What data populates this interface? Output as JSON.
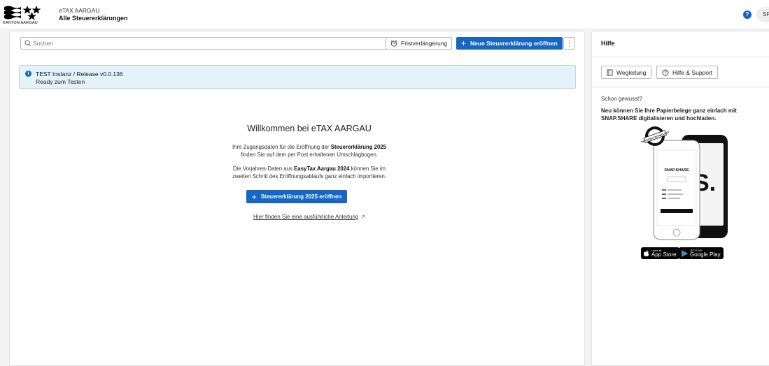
{
  "header": {
    "logo_text": "KANTON AARGAU",
    "app_name": "eTAX AARGAU",
    "page_title": "Alle Steuererklärungen",
    "help_icon_glyph": "?",
    "avatar_initials": "SP"
  },
  "toolbar": {
    "search_placeholder": "Suchen",
    "deadline_label": "Fristverlängerung",
    "new_return_label": "Neue Steuererklärung eröffnen",
    "more_glyph": "⋮"
  },
  "banner": {
    "title": "TEST Instanz / Release v0.0.136",
    "subtitle": "Ready zum Testen"
  },
  "welcome": {
    "heading": "Willkommen bei eTAX AARGAU",
    "p1_a": "Ihre Zugangsdaten für die Eröffnung der ",
    "p1_b": "Steuererklärung 2025",
    "p1_c": "finden Sie auf dem per Post erhaltenen Umschlagbogen.",
    "p2_a": "Die Vorjahres-Daten aus ",
    "p2_b": "EasyTax Aargau 2024",
    "p2_c": " können Sie im",
    "p2_d": "zweiten Schritt des Eröffnungsablaufs ganz einfach importieren.",
    "cta_label": "Steuererklärung 2025 eröffnen",
    "guide_link": "Hier finden Sie eine ausführliche Anleitung"
  },
  "help_panel": {
    "title": "Hilfe",
    "guide_button": "Wegleitung",
    "support_button": "Hilfe & Support",
    "tip_heading": "Schon gewusst?",
    "tip_body": "Neu können Sie Ihre Papierbelege ganz einfach mit SNAP.SHARE digitalisieren und hochladen.",
    "badge_text": "PATENTED TECHNOLOGY",
    "app_brand": "SNAP.SHARE",
    "app_store_small": "Laden im",
    "app_store_big": "App Store",
    "google_play_small": "JETZT BEI",
    "google_play_big": "Google Play"
  },
  "colors": {
    "primary": "#1667c4",
    "info_bg": "#e6f2fa",
    "info_border": "#b7d7ec"
  }
}
